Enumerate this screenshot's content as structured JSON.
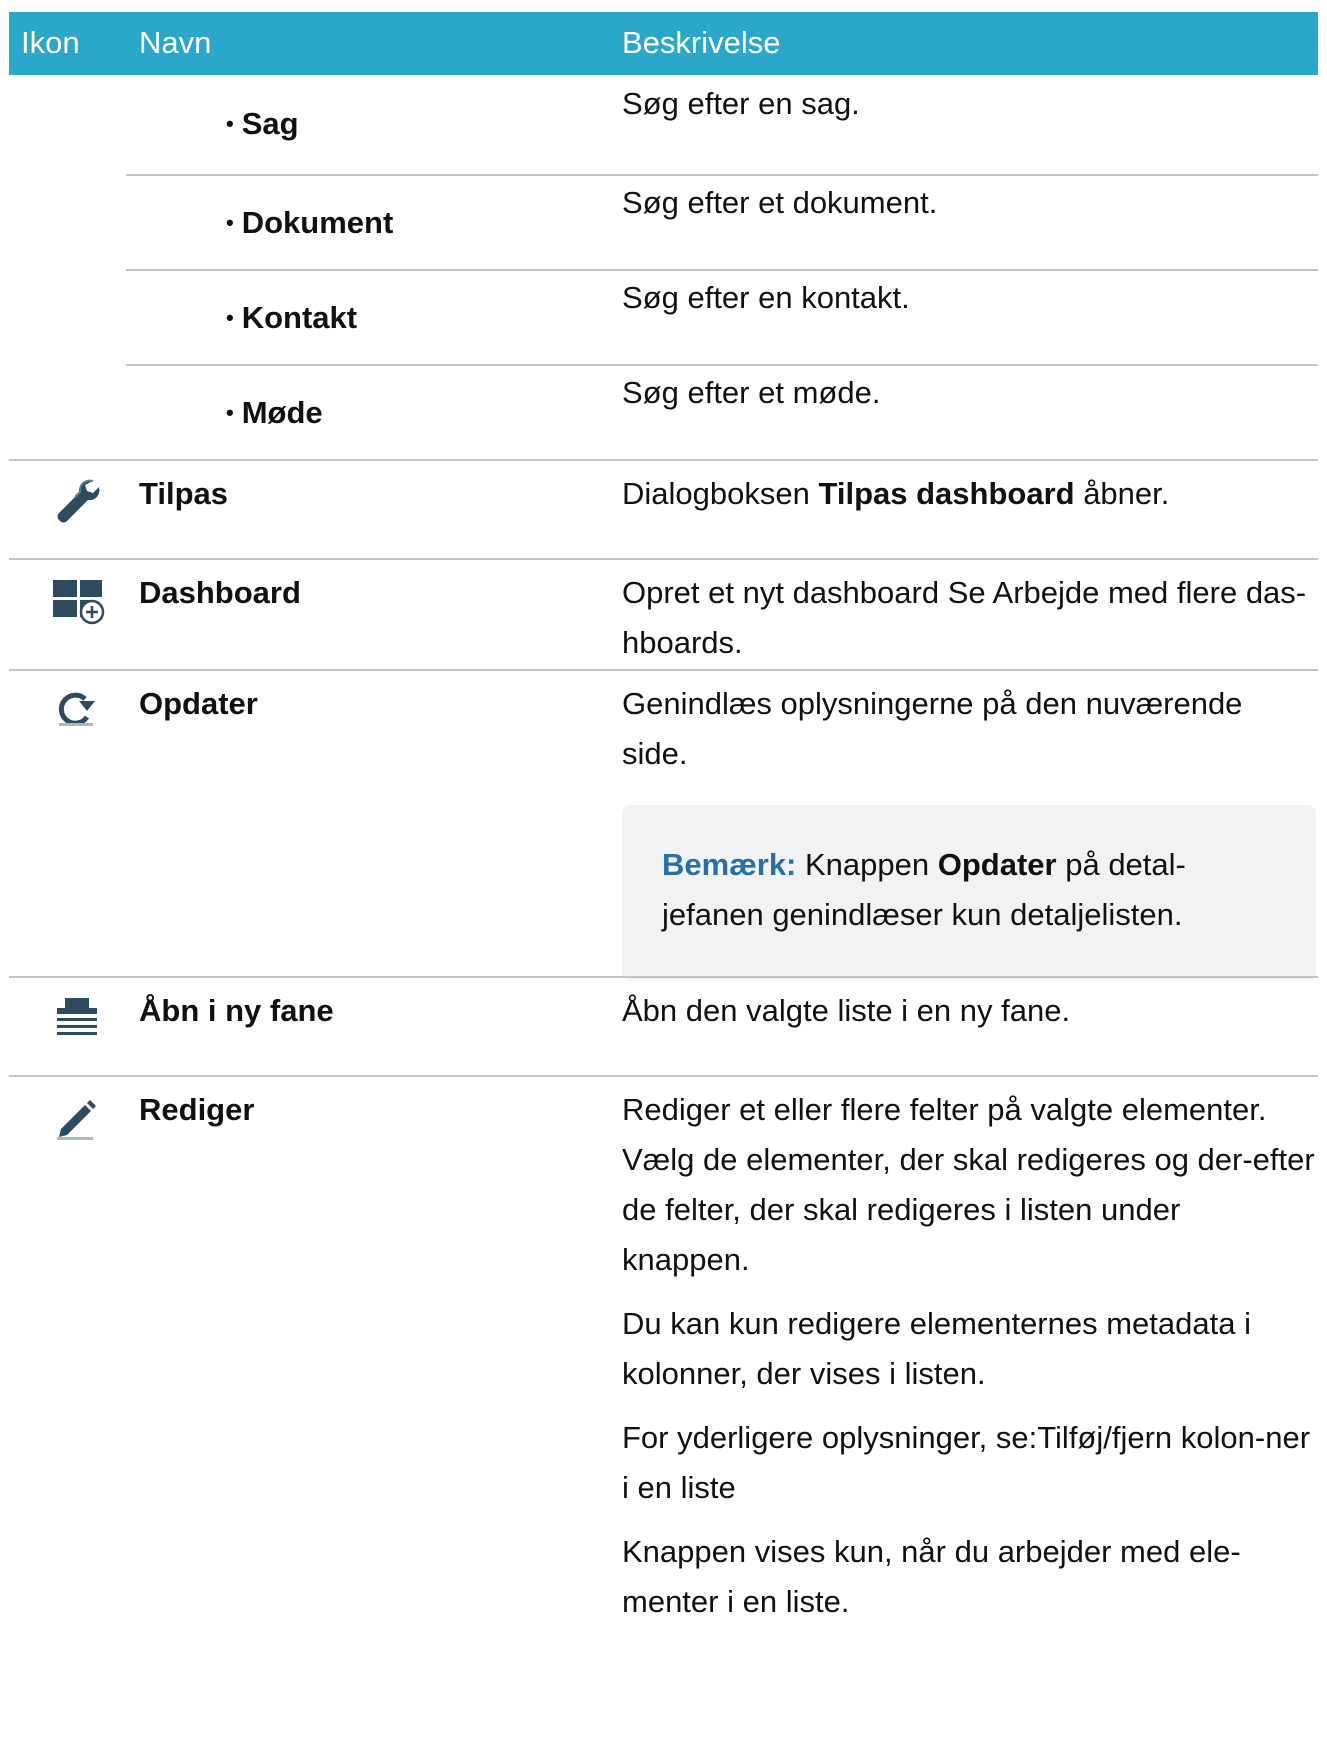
{
  "header": {
    "col_icon": "Ikon",
    "col_name": "Navn",
    "col_desc": "Beskrivelse"
  },
  "search_items": [
    {
      "name": "Sag",
      "desc": "Søg efter en sag."
    },
    {
      "name": "Dokument",
      "desc": "Søg efter et dokument."
    },
    {
      "name": "Kontakt",
      "desc": "Søg efter en kontakt."
    },
    {
      "name": "Møde",
      "desc": "Søg efter et møde."
    }
  ],
  "rows": {
    "tilpas": {
      "icon": "wrench-icon",
      "name": "Tilpas",
      "desc_pre": "Dialogboksen ",
      "desc_bold": "Tilpas dashboard",
      "desc_post": " åbner."
    },
    "dashboard": {
      "icon": "dashboard-add-icon",
      "name": "Dashboard",
      "desc": "Opret et nyt dashboard Se Arbejde med flere das-hboards."
    },
    "opdater": {
      "icon": "refresh-icon",
      "name": "Opdater",
      "desc": "Genindlæs oplysningerne på den nuværende side.",
      "note_label": "Bemærk:",
      "note_pre": " Knappen ",
      "note_bold": "Opdater",
      "note_post": " på detal-jefanen genindlæser kun detaljelisten."
    },
    "aabn": {
      "icon": "open-in-new-tab-icon",
      "name": "Åbn i ny fane",
      "desc": "Åbn den valgte liste i en ny fane."
    },
    "rediger": {
      "icon": "pencil-icon",
      "name": "Rediger",
      "paragraphs": [
        "Rediger et eller flere felter på valgte elementer. Vælg de elementer, der skal redigeres og der-efter de felter, der skal redigeres i listen under knappen.",
        "Du kan kun redigere elementernes metadata i kolonner, der vises i listen.",
        "For yderligere oplysninger, se:Tilføj/fjern kolon-ner i en liste",
        "Knappen vises kun, når du arbejder med ele-menter i en liste."
      ]
    }
  },
  "colors": {
    "header_bg": "#2aa7c9",
    "note_label": "#2a6ea6",
    "note_bg": "#f1f2f4",
    "divider": "#c4c4c4"
  }
}
